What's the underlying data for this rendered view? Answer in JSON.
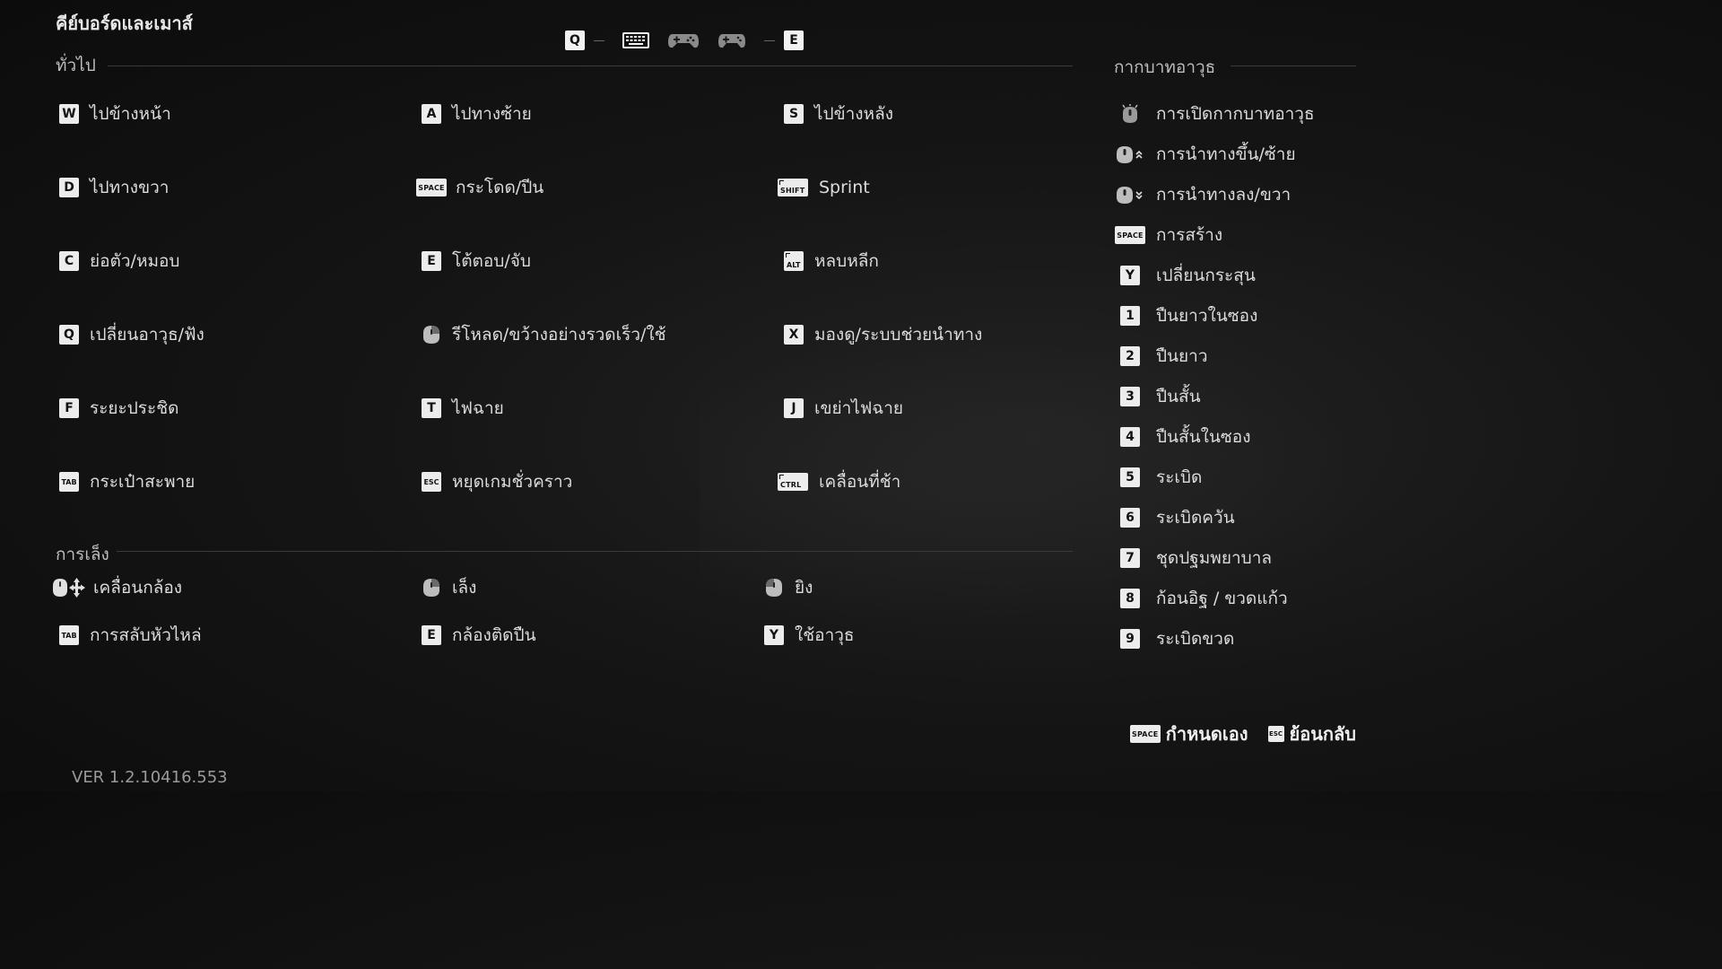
{
  "title": "คีย์บอร์ดและเมาส์",
  "topbar": {
    "left_key": "Q",
    "right_key": "E",
    "icons": [
      "keyboard-icon",
      "gamepad-icon",
      "gamepad-icon"
    ]
  },
  "general": {
    "heading": "ทั่วไป",
    "items": [
      {
        "key": "W",
        "label": "ไปข้างหน้า"
      },
      {
        "key": "A",
        "label": "ไปทางซ้าย"
      },
      {
        "key": "S",
        "label": "ไปข้างหลัง"
      },
      {
        "key": "D",
        "label": "ไปทางขวา"
      },
      {
        "key": "SPACE",
        "label": "กระโดด/ปีน"
      },
      {
        "key": "SHIFT",
        "label": "Sprint"
      },
      {
        "key": "C",
        "label": "ย่อตัว/หมอบ"
      },
      {
        "key": "E",
        "label": "โต้ตอบ/จับ"
      },
      {
        "key": "ALT",
        "label": "หลบหลีก"
      },
      {
        "key": "Q",
        "label": "เปลี่ยนอาวุธ/ฟัง"
      },
      {
        "key": "mouse-right",
        "label": "รีโหลด/ขว้างอย่างรวดเร็ว/ใช้"
      },
      {
        "key": "X",
        "label": "มองดู/ระบบช่วยนำทาง"
      },
      {
        "key": "F",
        "label": "ระยะประชิด"
      },
      {
        "key": "T",
        "label": "ไฟฉาย"
      },
      {
        "key": "J",
        "label": "เขย่าไฟฉาย"
      },
      {
        "key": "TAB",
        "label": "กระเป๋าสะพาย"
      },
      {
        "key": "ESC",
        "label": "หยุดเกมชั่วคราว"
      },
      {
        "key": "CTRL",
        "label": "เคลื่อนที่ช้า"
      }
    ]
  },
  "aiming": {
    "heading": "การเล็ง",
    "items": [
      {
        "key": "mouse-move",
        "label": "เคลื่อนกล้อง"
      },
      {
        "key": "mouse-right",
        "label": "เล็ง"
      },
      {
        "key": "mouse-left",
        "label": "ยิง"
      },
      {
        "key": "TAB",
        "label": "การสลับหัวไหล่"
      },
      {
        "key": "E",
        "label": "กล้องติดปืน"
      },
      {
        "key": "Y",
        "label": "ใช้อาวุธ"
      }
    ]
  },
  "weapon_wheel": {
    "heading": "กากบาทอาวุธ",
    "items": [
      {
        "key": "mouse-middle",
        "label": "การเปิดกากบาทอาวุธ"
      },
      {
        "key": "wheel-up",
        "label": "การนำทางขึ้น/ซ้าย"
      },
      {
        "key": "wheel-down",
        "label": "การนำทางลง/ขวา"
      },
      {
        "key": "SPACE",
        "label": "การสร้าง"
      },
      {
        "key": "Y",
        "label": "เปลี่ยนกระสุน"
      },
      {
        "key": "1",
        "label": "ปืนยาวในซอง"
      },
      {
        "key": "2",
        "label": "ปืนยาว"
      },
      {
        "key": "3",
        "label": "ปืนสั้น"
      },
      {
        "key": "4",
        "label": "ปืนสั้นในซอง"
      },
      {
        "key": "5",
        "label": "ระเบิด"
      },
      {
        "key": "6",
        "label": "ระเบิดควัน"
      },
      {
        "key": "7",
        "label": "ชุดปฐมพยาบาล"
      },
      {
        "key": "8",
        "label": "ก้อนอิฐ / ขวดแก้ว"
      },
      {
        "key": "9",
        "label": "ระเบิดขวด"
      }
    ]
  },
  "footer": {
    "customize_key": "SPACE",
    "customize_label": "กำหนดเอง",
    "back_key": "ESC",
    "back_label": "ย้อนกลับ"
  },
  "version": "VER 1.2.10416.553"
}
